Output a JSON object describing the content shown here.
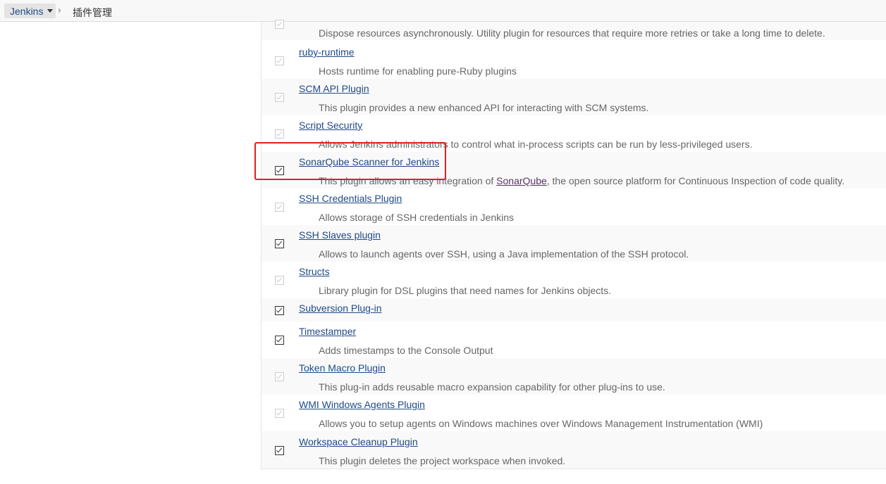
{
  "breadcrumb": {
    "root": "Jenkins",
    "current": "插件管理"
  },
  "plugins": [
    {
      "name": "",
      "desc": "Dispose resources asynchronously. Utility plugin for resources that require more retries or take a long time to delete.",
      "checked": true,
      "disabled": true
    },
    {
      "name": "ruby-runtime",
      "desc": "Hosts runtime for enabling pure-Ruby plugins",
      "checked": true,
      "disabled": true
    },
    {
      "name": "SCM API Plugin",
      "desc": "This plugin provides a new enhanced API for interacting with SCM systems.",
      "checked": true,
      "disabled": true
    },
    {
      "name": "Script Security",
      "desc": "Allows Jenkins administrators to control what in-process scripts can be run by less-privileged users.",
      "checked": true,
      "disabled": true
    },
    {
      "name": "SonarQube Scanner for Jenkins",
      "desc_before": "This plugin allows an easy integration of ",
      "desc_link": "SonarQube",
      "desc_after": ", the open source platform for Continuous Inspection of code quality.",
      "checked": true,
      "disabled": false
    },
    {
      "name": "SSH Credentials Plugin",
      "desc": "Allows storage of SSH credentials in Jenkins",
      "checked": true,
      "disabled": true
    },
    {
      "name": "SSH Slaves plugin",
      "desc": "Allows to launch agents over SSH, using a Java implementation of the SSH protocol.",
      "checked": true,
      "disabled": false
    },
    {
      "name": "Structs",
      "desc": "Library plugin for DSL plugins that need names for Jenkins objects.",
      "checked": true,
      "disabled": true
    },
    {
      "name": "Subversion Plug-in",
      "desc": "",
      "checked": true,
      "disabled": false
    },
    {
      "name": "Timestamper",
      "desc": "Adds timestamps to the Console Output",
      "checked": true,
      "disabled": false
    },
    {
      "name": "Token Macro Plugin",
      "desc": "This plug-in adds reusable macro expansion capability for other plug-ins to use.",
      "checked": true,
      "disabled": true
    },
    {
      "name": "WMI Windows Agents Plugin",
      "desc": "Allows you to setup agents on Windows machines over Windows Management Instrumentation (WMI)",
      "checked": true,
      "disabled": true
    },
    {
      "name": "Workspace Cleanup Plugin",
      "desc": "This plugin deletes the project workspace when invoked.",
      "checked": true,
      "disabled": false
    }
  ],
  "colors": {
    "link": "#204a87",
    "visited_link": "#5c3566",
    "description": "#666666",
    "highlight": "#e0201c"
  }
}
